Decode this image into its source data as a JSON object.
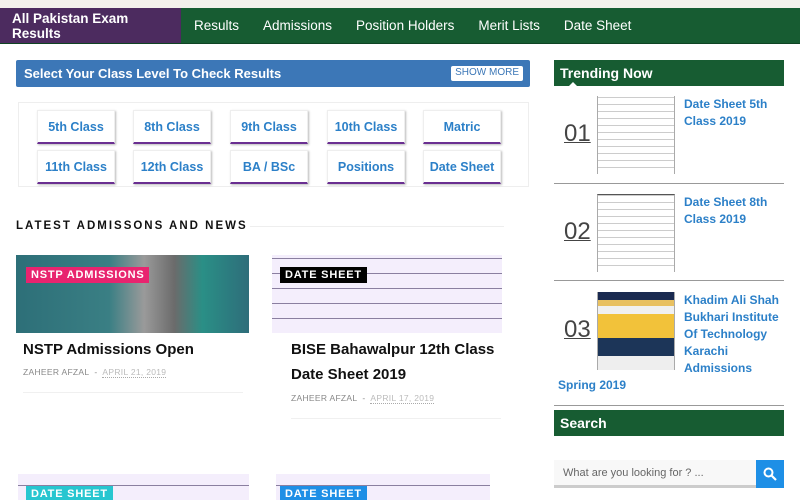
{
  "nav": {
    "brand": "All Pakistan Exam Results",
    "items": [
      "Results",
      "Admissions",
      "Position Holders",
      "Merit Lists",
      "Date Sheet"
    ]
  },
  "select": {
    "title": "Select Your Class Level To Check Results",
    "show_more": "SHOW MORE",
    "classes": [
      "5th Class",
      "8th Class",
      "9th Class",
      "10th Class",
      "Matric",
      "11th Class",
      "12th Class",
      "BA / BSc",
      "Positions",
      "Date Sheet"
    ]
  },
  "news": {
    "heading": "LATEST ADMISSONS AND NEWS",
    "posts": [
      {
        "badge": "NSTP ADMISSIONS",
        "badge_color": "#e8246f",
        "title": "NSTP Admissions Open",
        "author": "ZAHEER AFZAL",
        "date": "APRIL 21, 2019"
      },
      {
        "badge": "DATE SHEET",
        "badge_color": "#000000",
        "title": "BISE Bahawalpur 12th Class Date Sheet 2019",
        "author": "ZAHEER AFZAL",
        "date": "APRIL 17, 2019"
      },
      {
        "badge": "DATE SHEET",
        "badge_color": "#27c6d0"
      },
      {
        "badge": "DATE SHEET",
        "badge_color": "#1e8fe6"
      }
    ]
  },
  "sidebar": {
    "trending_title": "Trending Now",
    "trending": [
      {
        "num": "01",
        "title": "Date Sheet 5th Class 2019"
      },
      {
        "num": "02",
        "title": "Date Sheet 8th Class 2019"
      },
      {
        "num": "03",
        "title": "Khadim Ali Shah Bukhari Institute Of Technology Karachi Admissions",
        "title_cont": "Spring 2019"
      }
    ],
    "search_title": "Search",
    "search_placeholder": "What are you looking for ? ...",
    "search_icon": "search-icon"
  },
  "colors": {
    "nav": "#175c32",
    "brand": "#4c2b5f",
    "accent": "#3c77b7",
    "link": "#2c80c8"
  }
}
